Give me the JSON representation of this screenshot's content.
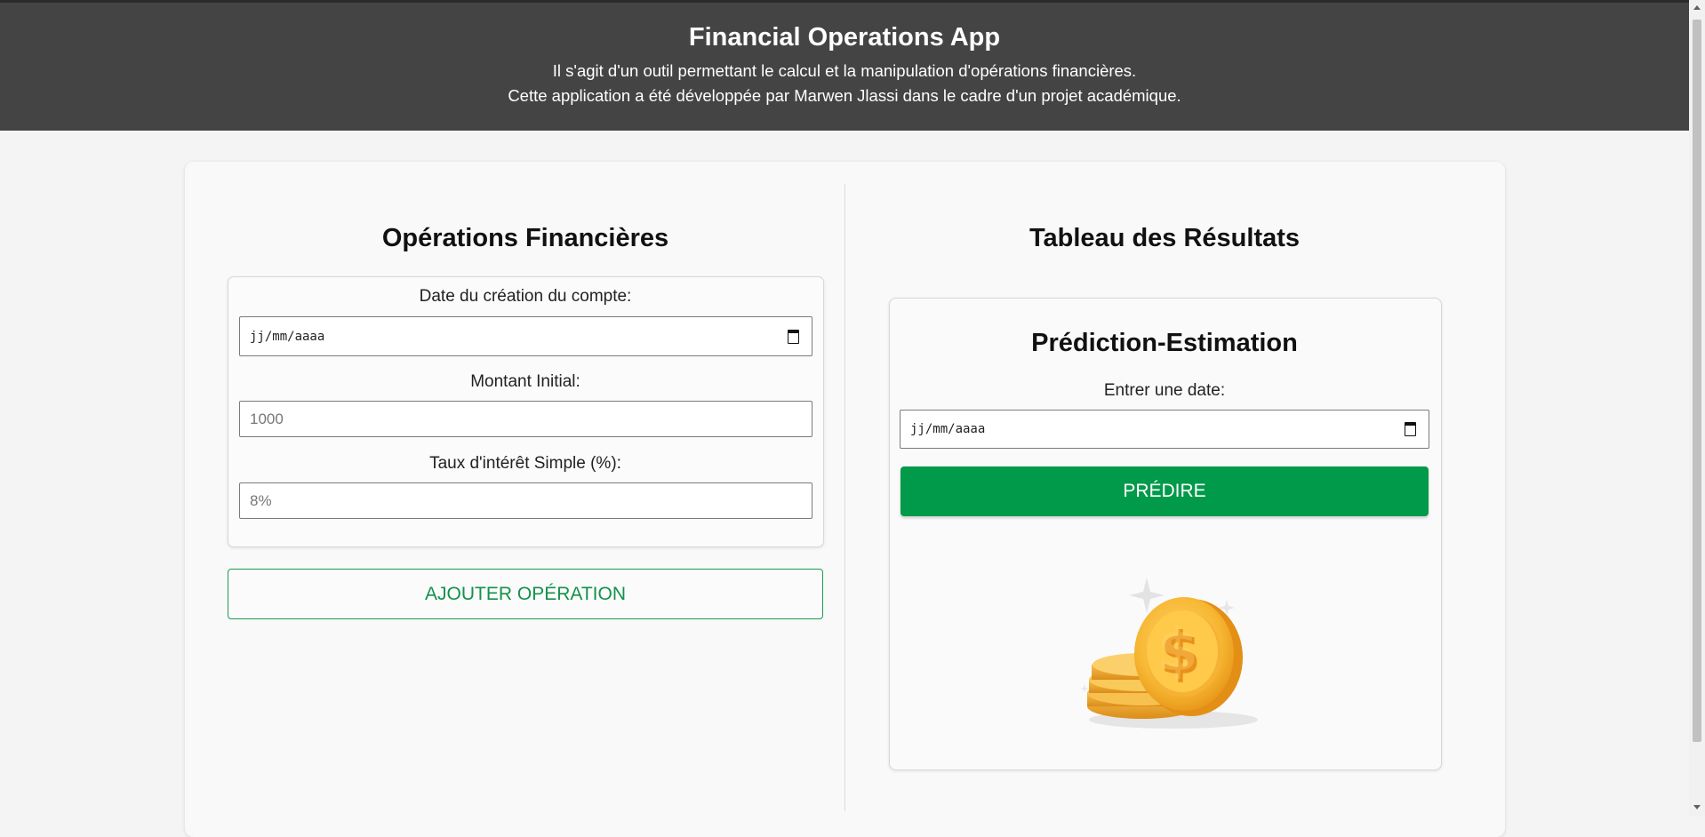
{
  "header": {
    "title": "Financial Operations App",
    "subtitle_line1": "Il s'agit d'un outil permettant le calcul et la manipulation d'opérations financières.",
    "subtitle_line2": "Cette application a été développée par Marwen Jlassi dans le cadre d'un projet académique."
  },
  "left": {
    "title": "Opérations Financières",
    "date_label": "Date du création du compte:",
    "date_placeholder": "jj/mm/aaaa",
    "amount_label": "Montant Initial:",
    "amount_placeholder": "1000",
    "rate_label": "Taux d'intérêt Simple (%):",
    "rate_placeholder": "8%",
    "add_button": "AJOUTER OPÉRATION"
  },
  "right": {
    "title": "Tableau des Résultats",
    "prediction_title": "Prédiction-Estimation",
    "date_label": "Entrer une date:",
    "date_placeholder": "jj/mm/aaaa",
    "predict_button": "PRÉDIRE",
    "illustration": "dollar-coins-illustration"
  },
  "colors": {
    "header_bg": "#444444",
    "accent_green": "#009a4a",
    "page_bg": "#f4f4f4"
  },
  "icons": {
    "calendar": "calendar-icon",
    "coin": "dollar-coin-icon"
  }
}
